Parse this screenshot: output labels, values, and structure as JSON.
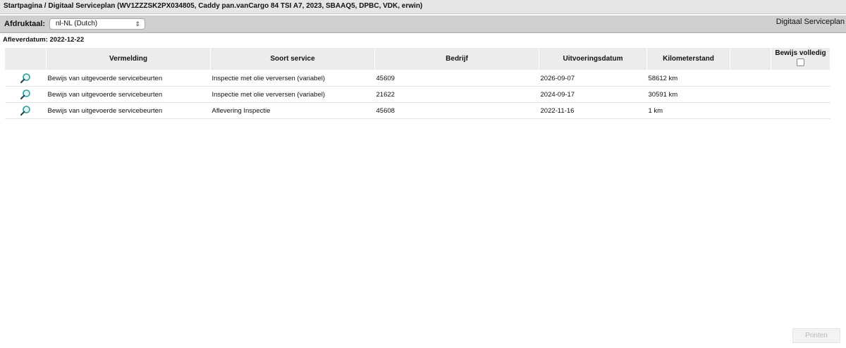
{
  "breadcrumb": "Startpagina / Digitaal Serviceplan (WV1ZZZSK2PX034805, Caddy pan.vanCargo 84 TSI A7, 2023, SBAAQ5, DPBC, VDK, erwin)",
  "toolbar": {
    "language_label": "Afdruktaal:",
    "language_value": "nl-NL (Dutch)",
    "page_heading": "Digitaal Serviceplan"
  },
  "delivery_date": "Afleverdatum: 2022-12-22",
  "table": {
    "headers": [
      "Vermelding",
      "Soort service",
      "Bedrijf",
      "Uitvoeringsdatum",
      "Kilometerstand",
      "",
      "Bewijs volledig"
    ],
    "rows": [
      {
        "vermelding": "Bewijs van uitgevoerde servicebeurten",
        "soort": "Inspectie met olie verversen (variabel)",
        "bedrijf": "45609",
        "datum": "2026-09-07",
        "km": "58612 km"
      },
      {
        "vermelding": "Bewijs van uitgevoerde servicebeurten",
        "soort": "Inspectie met olie verversen (variabel)",
        "bedrijf": "21622",
        "datum": "2024-09-17",
        "km": "30591 km"
      },
      {
        "vermelding": "Bewijs van uitgevoerde servicebeurten",
        "soort": "Aflevering Inspectie",
        "bedrijf": "45608",
        "datum": "2022-11-16",
        "km": "1 km"
      }
    ]
  },
  "footer": {
    "print_label": "Printen"
  },
  "icons": {
    "row_action": "magnifier-icon",
    "select": "chevron-updown-icon"
  },
  "colors": {
    "toolbar_bg": "#cfcfcf",
    "header_bg": "#ececec",
    "icon_teal": "#2a9d9b"
  }
}
